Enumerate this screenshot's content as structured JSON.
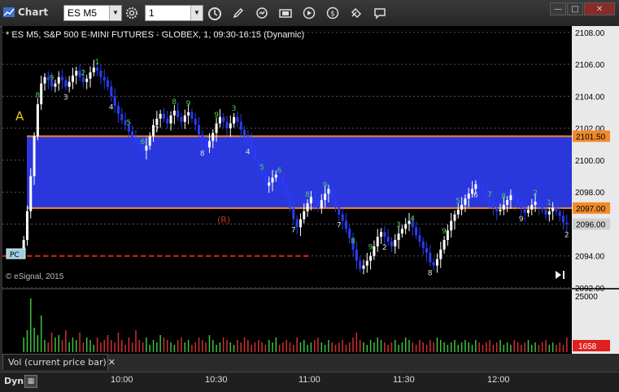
{
  "window": {
    "title": "Chart",
    "symbol": "ES M5",
    "interval": "1",
    "minimize": "—",
    "maximize": "□",
    "close": "✕"
  },
  "chart": {
    "header": "* ES M5, S&P 500 E-MINI FUTURES - GLOBEX, 1, 09:30-16:15 (Dynamic)",
    "copyright": "© eSignal, 2015",
    "marker_a": "A",
    "marker_r": "(R)",
    "marker_pc": "PC",
    "price_axis": [
      "2108.00",
      "2106.00",
      "2104.00",
      "2102.00",
      "2100.00",
      "2098.00",
      "2096.00",
      "2094.00",
      "2092.00"
    ],
    "upper_line_label": "2101.50",
    "lower_line_label": "2097.00",
    "last_price_label": "2096.00",
    "td_counts": [
      "7",
      "8",
      "9",
      "3",
      "2",
      "1",
      "4",
      "5",
      "6",
      "7",
      "8",
      "9",
      "8",
      "9",
      "3",
      "4",
      "5",
      "6",
      "7",
      "8",
      "9",
      "7",
      "8",
      "9",
      "2",
      "3",
      "4",
      "8",
      "9",
      "5",
      "6",
      "7",
      "8",
      "9",
      "2",
      "1",
      "2"
    ],
    "chart_data": {
      "type": "candlestick",
      "x_range": [
        "09:30",
        "12:15"
      ],
      "ylim": [
        2092,
        2108.4
      ],
      "bands": [
        {
          "from": 2097.0,
          "to": 2101.5,
          "color": "#2e3cf0"
        }
      ],
      "lines": [
        {
          "y": 2101.5,
          "color": "#f08a2a"
        },
        {
          "y": 2097.0,
          "color": "#f08a2a"
        },
        {
          "y": 2094.0,
          "color": "#e02020",
          "dashed": true
        }
      ],
      "closes": [
        2095.0,
        2096.8,
        2099.0,
        2101.5,
        2103.5,
        2104.8,
        2105.2,
        2105.0,
        2104.6,
        2104.8,
        2105.2,
        2105.0,
        2104.6,
        2104.9,
        2105.3,
        2105.6,
        2105.2,
        2104.9,
        2105.1,
        2105.5,
        2105.8,
        2105.6,
        2105.2,
        2105.0,
        2104.6,
        2104.0,
        2103.4,
        2102.9,
        2102.5,
        2102.2,
        2101.8,
        2101.4,
        2101.2,
        2101.0,
        2100.6,
        2100.9,
        2101.5,
        2102.2,
        2102.6,
        2102.9,
        2102.6,
        2102.3,
        2102.8,
        2103.1,
        2102.7,
        2102.4,
        2102.8,
        2103.0,
        2102.6,
        2102.2,
        2101.6,
        2101.1,
        2100.8,
        2101.2,
        2101.7,
        2102.3,
        2102.7,
        2102.4,
        2102.0,
        2102.3,
        2102.7,
        2102.4,
        2101.9,
        2101.5,
        2101.2,
        2100.6,
        2100.1,
        2099.6,
        2099.0,
        2098.4,
        2098.6,
        2098.9,
        2099.1,
        2098.8,
        2098.4,
        2097.8,
        2097.0,
        2096.3,
        2095.8,
        2096.3,
        2096.8,
        2097.3,
        2097.7,
        2097.4,
        2097.0,
        2097.5,
        2097.9,
        2098.2,
        2097.6,
        2097.1,
        2096.6,
        2096.2,
        2095.7,
        2095.1,
        2094.4,
        2093.7,
        2093.2,
        2093.4,
        2093.7,
        2094.0,
        2094.6,
        2095.2,
        2095.5,
        2095.2,
        2094.9,
        2094.6,
        2095.0,
        2095.4,
        2095.7,
        2096.0,
        2096.2,
        2095.8,
        2095.3,
        2094.9,
        2094.5,
        2094.2,
        2093.6,
        2093.4,
        2093.8,
        2094.4,
        2095.0,
        2095.6,
        2096.2,
        2096.6,
        2096.9,
        2097.2,
        2097.6,
        2097.9,
        2098.2,
        2098.5,
        2098.2,
        2097.9,
        2097.6,
        2097.3,
        2097.0,
        2096.8,
        2096.9,
        2097.2,
        2097.5,
        2097.8,
        2097.6,
        2097.3,
        2097.0,
        2096.7,
        2096.9,
        2097.2,
        2097.4,
        2097.1,
        2096.9,
        2096.6,
        2096.8,
        2097.0,
        2096.8,
        2096.5,
        2096.1,
        2096.0
      ],
      "volume": {
        "ylim": [
          0,
          25000
        ],
        "label": "Vol (current price bar)",
        "last_value_label": "1658",
        "axis_label": "25000"
      }
    }
  },
  "time_axis": [
    "10:00",
    "10:30",
    "11:00",
    "11:30",
    "12:00"
  ],
  "bottom": {
    "dyn": "Dyn"
  }
}
